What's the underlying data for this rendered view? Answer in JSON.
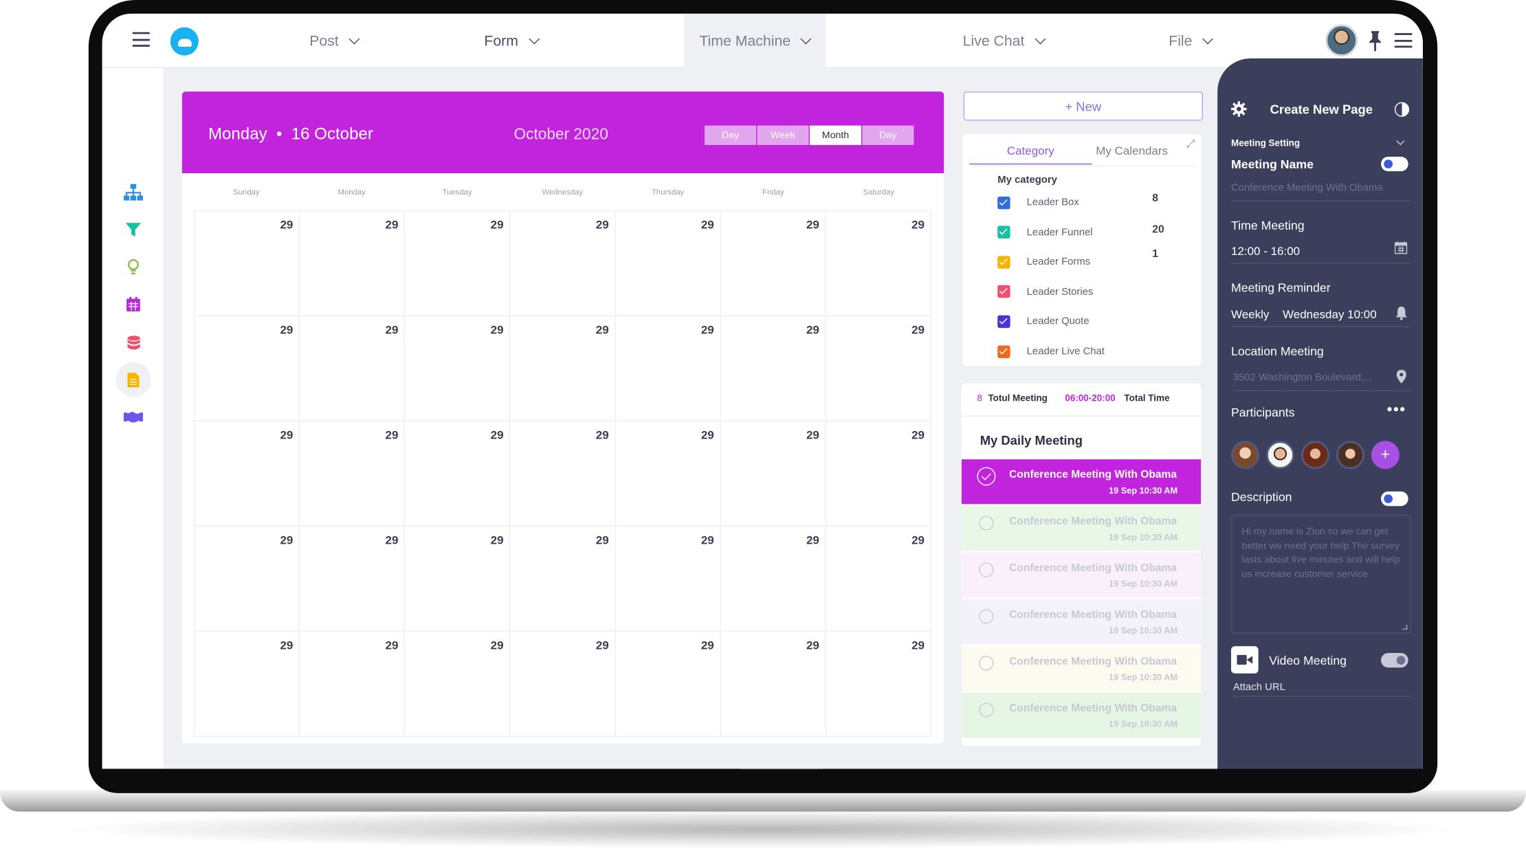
{
  "topbar": {
    "nav": [
      {
        "label": "Post"
      },
      {
        "label": "Form"
      },
      {
        "label": "Time Machine"
      },
      {
        "label": "Live Chat"
      },
      {
        "label": "File"
      }
    ],
    "active_nav": "Time Machine"
  },
  "sidebar": {
    "icons": [
      "sitemap-icon",
      "filter-icon",
      "lightbulb-icon",
      "calendar-icon",
      "database-icon",
      "document-icon",
      "handshake-icon"
    ],
    "active_icon": "document-icon",
    "icon_colors": [
      "#2e8fe0",
      "#1bbfa3",
      "#8bc34a",
      "#b529d6",
      "#f0506e",
      "#f4b400",
      "#6e56e8"
    ]
  },
  "calendar": {
    "selected_date": "Monday  •  16 October",
    "month_label": "October 2020",
    "views": [
      {
        "label": "Day",
        "active": false
      },
      {
        "label": "Week",
        "active": false
      },
      {
        "label": "Month",
        "active": true
      },
      {
        "label": "Day",
        "active": false
      }
    ],
    "weekdays": [
      "Sunday",
      "Monday",
      "Tuesday",
      "Wednesday",
      "Thursday",
      "Friday",
      "Saturday"
    ],
    "weeks": [
      [
        "29",
        "29",
        "29",
        "29",
        "29",
        "29",
        "29"
      ],
      [
        "29",
        "29",
        "29",
        "29",
        "29",
        "29",
        "29"
      ],
      [
        "29",
        "29",
        "29",
        "29",
        "29",
        "29",
        "29"
      ],
      [
        "29",
        "29",
        "29",
        "29",
        "29",
        "29",
        "29"
      ],
      [
        "29",
        "29",
        "29",
        "29",
        "29",
        "29",
        "29"
      ]
    ],
    "header_color": "#c223dc"
  },
  "new_button": {
    "label": "+ New"
  },
  "category_panel": {
    "tabs": [
      {
        "label": "Category",
        "active": true
      },
      {
        "label": "My Calendars",
        "active": false
      }
    ],
    "heading": "My category",
    "items": [
      {
        "label": "Leader Box",
        "count": "8",
        "color": "#2e6fdc"
      },
      {
        "label": "Leader Funnel",
        "count": "20",
        "color": "#1bbfa3"
      },
      {
        "label": "Leader Forms",
        "count": "1",
        "color": "#f4b400"
      },
      {
        "label": "Leader Stories",
        "count": "",
        "color": "#f0506e"
      },
      {
        "label": "Leader Quote",
        "count": "",
        "color": "#4a32d6"
      },
      {
        "label": "Leader Live Chat",
        "count": "",
        "color": "#f26b1d"
      }
    ]
  },
  "meetings": {
    "total_count": "8",
    "total_label": "Totul Meeting",
    "time_range": "06:00-20:00",
    "total_time_label": "Total Time",
    "title": "My Daily Meeting",
    "items": [
      {
        "name": "Conference Meeting With Obama",
        "date": "19 Sep 10:30 AM",
        "active": true,
        "bg": "#c223dc"
      },
      {
        "name": "Conference Meeting With Obama",
        "date": "19 Sep 10:30 AM",
        "active": false,
        "bg": "#e8f7e6"
      },
      {
        "name": "Conference Meeting With Obama",
        "date": "19 Sep 10:30 AM",
        "active": false,
        "bg": "#f9f0fb"
      },
      {
        "name": "Conference Meeting With Obama",
        "date": "19 Sep 10:30 AM",
        "active": false,
        "bg": "#f3f2fb"
      },
      {
        "name": "Conference Meeting With Obama",
        "date": "19 Sep 10:30 AM",
        "active": false,
        "bg": "#fdfaf0"
      },
      {
        "name": "Conference Meeting With Obama",
        "date": "19 Sep 10:30 AM",
        "active": false,
        "bg": "#e6f6e4"
      }
    ]
  },
  "right_panel": {
    "title": "Create New Page",
    "meeting_setting_label": "Meeting Setting",
    "meeting_name_label": "Meeting Name",
    "meeting_name_placeholder": "Conference Meeting With Obama",
    "time_label": "Time Meeting",
    "time_value": "12:00 - 16:00",
    "reminder_label": "Meeting Reminder",
    "reminder_frequency": "Weekly",
    "reminder_day": "Wednesday 10:00",
    "location_label": "Location Meeting",
    "location_placeholder": "3502 Washington Boulevard,...",
    "participants_label": "Participants",
    "participants_add": "+",
    "description_label": "Description",
    "description_placeholder": "Hi my name is Zion so we can get better we need your help The survey lasts about five minutes and will help us increase customer service",
    "video_label": "Video Meeting",
    "attach_url": "Attach URL",
    "panel_color": "#3c3f5c"
  }
}
